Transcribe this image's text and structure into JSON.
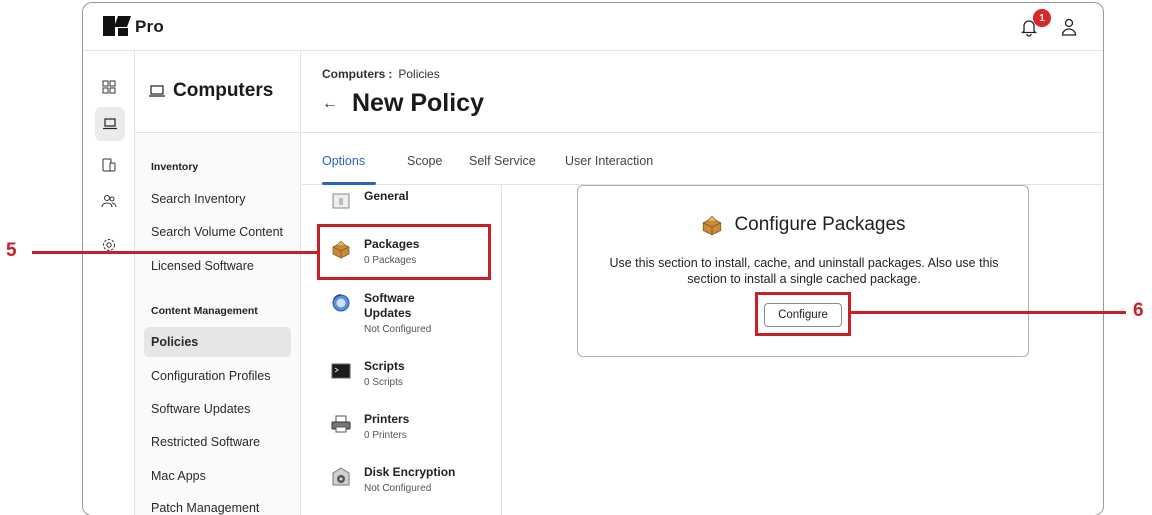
{
  "app": {
    "brand": "Pro",
    "notifications_count": "1"
  },
  "section": {
    "title": "Computers"
  },
  "nav": {
    "groups": [
      {
        "label": "Inventory"
      },
      {
        "label": "Content Management"
      }
    ],
    "items": [
      {
        "label": "Search Inventory"
      },
      {
        "label": "Search Volume Content"
      },
      {
        "label": "Licensed Software"
      },
      {
        "label": "Policies"
      },
      {
        "label": "Configuration Profiles"
      },
      {
        "label": "Software Updates"
      },
      {
        "label": "Restricted Software"
      },
      {
        "label": "Mac Apps"
      },
      {
        "label": "Patch Management"
      }
    ]
  },
  "breadcrumb": {
    "parent": "Computers",
    "separator": ":",
    "current": "Policies"
  },
  "page": {
    "title": "New Policy"
  },
  "tabs": [
    {
      "label": "Options"
    },
    {
      "label": "Scope"
    },
    {
      "label": "Self Service"
    },
    {
      "label": "User Interaction"
    }
  ],
  "options": [
    {
      "name": "General",
      "sub": ""
    },
    {
      "name": "Packages",
      "sub": "0 Packages"
    },
    {
      "name": "Software Updates",
      "sub": "Not Configured"
    },
    {
      "name": "Scripts",
      "sub": "0 Scripts"
    },
    {
      "name": "Printers",
      "sub": "0 Printers"
    },
    {
      "name": "Disk Encryption",
      "sub": "Not Configured"
    }
  ],
  "card": {
    "title": "Configure Packages",
    "description": "Use this section to install, cache, and uninstall packages. Also use this section to install a single cached package.",
    "button": "Configure"
  },
  "callouts": {
    "left": "5",
    "right": "6"
  },
  "colors": {
    "accent": "#2a62c9",
    "callout": "#c8202a",
    "badge": "#d8262c"
  }
}
